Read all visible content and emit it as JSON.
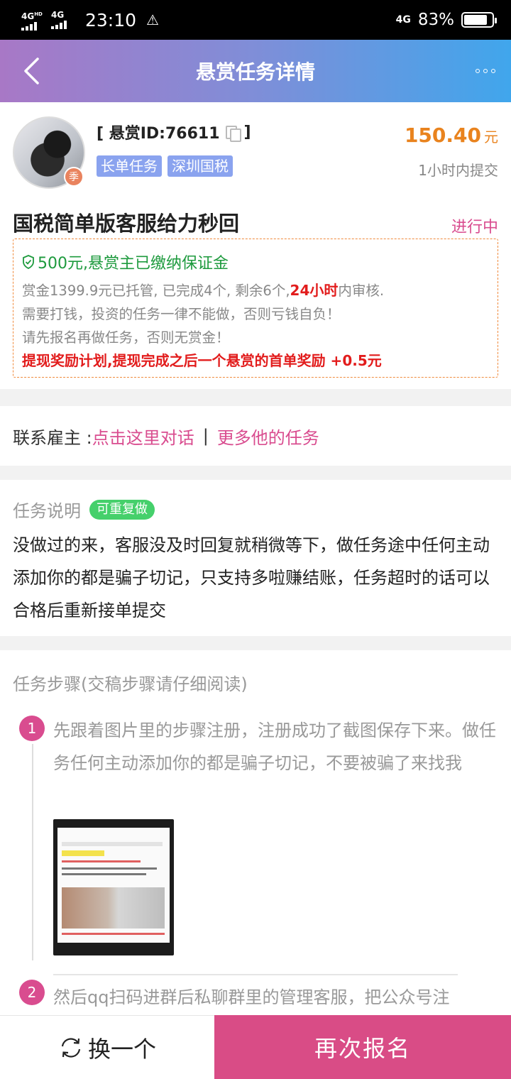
{
  "status_bar": {
    "net1": "4G",
    "net1_sup": "HD",
    "net2": "4G",
    "time": "23:10",
    "warning": "⚠",
    "net3": "4G",
    "battery": "83%"
  },
  "header": {
    "title": "悬赏任务详情"
  },
  "task": {
    "avatar_badge": "季",
    "reward_id_prefix": "[ 悬赏ID:76611",
    "reward_id_suffix": "]",
    "tags": [
      "长单任务",
      "深圳国税"
    ],
    "price": "150.40",
    "price_unit": "元",
    "deadline": "1小时内提交",
    "title": "国税简单版客服给力秒回",
    "status": "进行中"
  },
  "notice": {
    "deposit": "500元,悬赏主已缴纳保证金",
    "line1_pre": "赏金1399.9元已托管, 已完成4个, 剩余6个,",
    "line1_hl": "24小时",
    "line1_post": "内审核.",
    "line2": "需要打钱，投资的任务一律不能做，否则亏钱自负！",
    "line3": "请先报名再做任务，否则无赏金！",
    "bonus": "提现奖励计划,提现完成之后一个悬赏的首单奖励 +0.5元"
  },
  "contact": {
    "label": "联系雇主 : ",
    "chat_link": "点击这里对话",
    "divider": "|",
    "more_link": "更多他的任务"
  },
  "description": {
    "title": "任务说明",
    "badge": "可重复做",
    "body": "没做过的来，客服没及时回复就稍微等下，做任务途中任何主动添加你的都是骗子切记，只支持多啦赚结账，任务超时的话可以合格后重新接单提交"
  },
  "steps": {
    "title": "任务步骤(交稿步骤请仔细阅读)",
    "items": [
      {
        "num": "1",
        "text": "先跟着图片里的步骤注册，注册成功了截图保存下来。做任务任何主动添加你的都是骗子切记，不要被骗了来找我"
      },
      {
        "num": "2",
        "text": "然后qq扫码进群后私聊群里的管理客服，把公众号注"
      }
    ]
  },
  "bottom": {
    "swap_label": "换一个",
    "signup_label": "再次报名"
  },
  "colors": {
    "accent": "#d94c8f",
    "price": "#e9831e",
    "tag": "#8aa3ef",
    "success": "#1d9a3d",
    "warning_red": "#e21c1c",
    "header_gradient_start": "#a878c6",
    "header_gradient_end": "#40a6ec"
  },
  "icons": {
    "back": "chevron-left-icon",
    "more": "more-dots-icon",
    "copy": "copy-icon",
    "shield": "shield-check-icon",
    "swap": "refresh-icon"
  }
}
